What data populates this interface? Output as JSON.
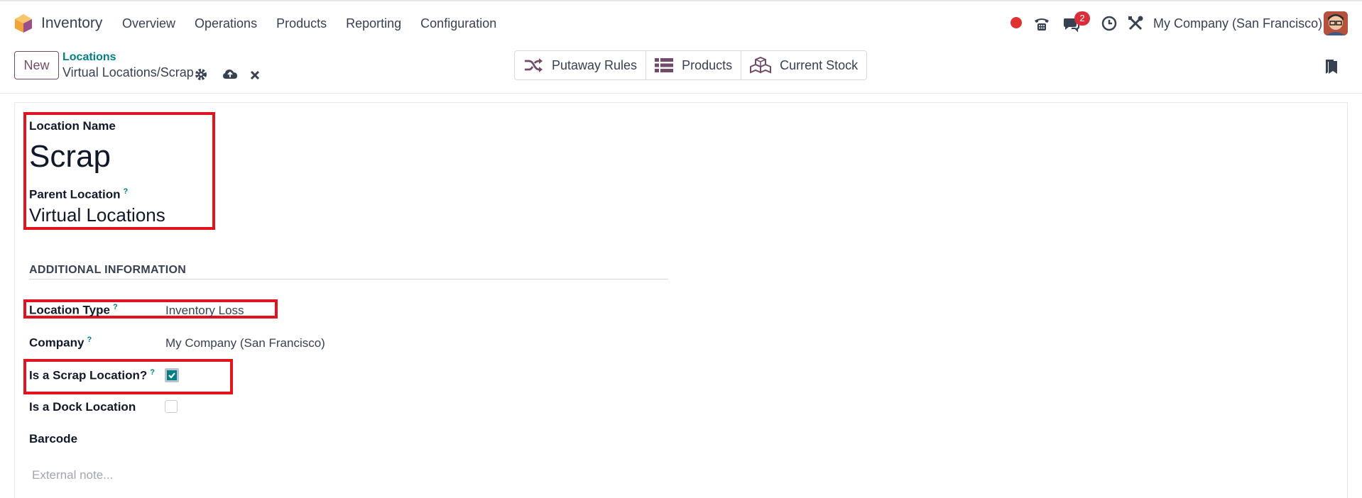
{
  "app": {
    "name": "Inventory"
  },
  "nav": {
    "menu": [
      {
        "label": "Overview"
      },
      {
        "label": "Operations"
      },
      {
        "label": "Products"
      },
      {
        "label": "Reporting"
      },
      {
        "label": "Configuration"
      }
    ],
    "messages_badge": "2",
    "company": "My Company (San Francisco)"
  },
  "control": {
    "new_label": "New",
    "breadcrumb_parent": "Locations",
    "breadcrumb_current": "Virtual Locations/Scrap",
    "smart_buttons": [
      {
        "label": "Putaway Rules",
        "icon": "shuffle-icon"
      },
      {
        "label": "Products",
        "icon": "list-icon"
      },
      {
        "label": "Current Stock",
        "icon": "cubes-icon"
      }
    ]
  },
  "form": {
    "location_name_label": "Location Name",
    "location_name": "Scrap",
    "parent_location_label": "Parent Location",
    "parent_location": "Virtual Locations",
    "help_mark": "?",
    "section_title": "ADDITIONAL INFORMATION",
    "location_type_label": "Location Type",
    "location_type": "Inventory Loss",
    "company_label": "Company",
    "company": "My Company (San Francisco)",
    "scrap_label": "Is a Scrap Location?",
    "scrap_checked": true,
    "dock_label": "Is a Dock Location",
    "dock_checked": false,
    "barcode_label": "Barcode",
    "note_placeholder": "External note..."
  },
  "colors": {
    "brand": "#714b67",
    "link": "#017e84",
    "highlight": "#e0141e",
    "badge": "#d92d3a"
  }
}
